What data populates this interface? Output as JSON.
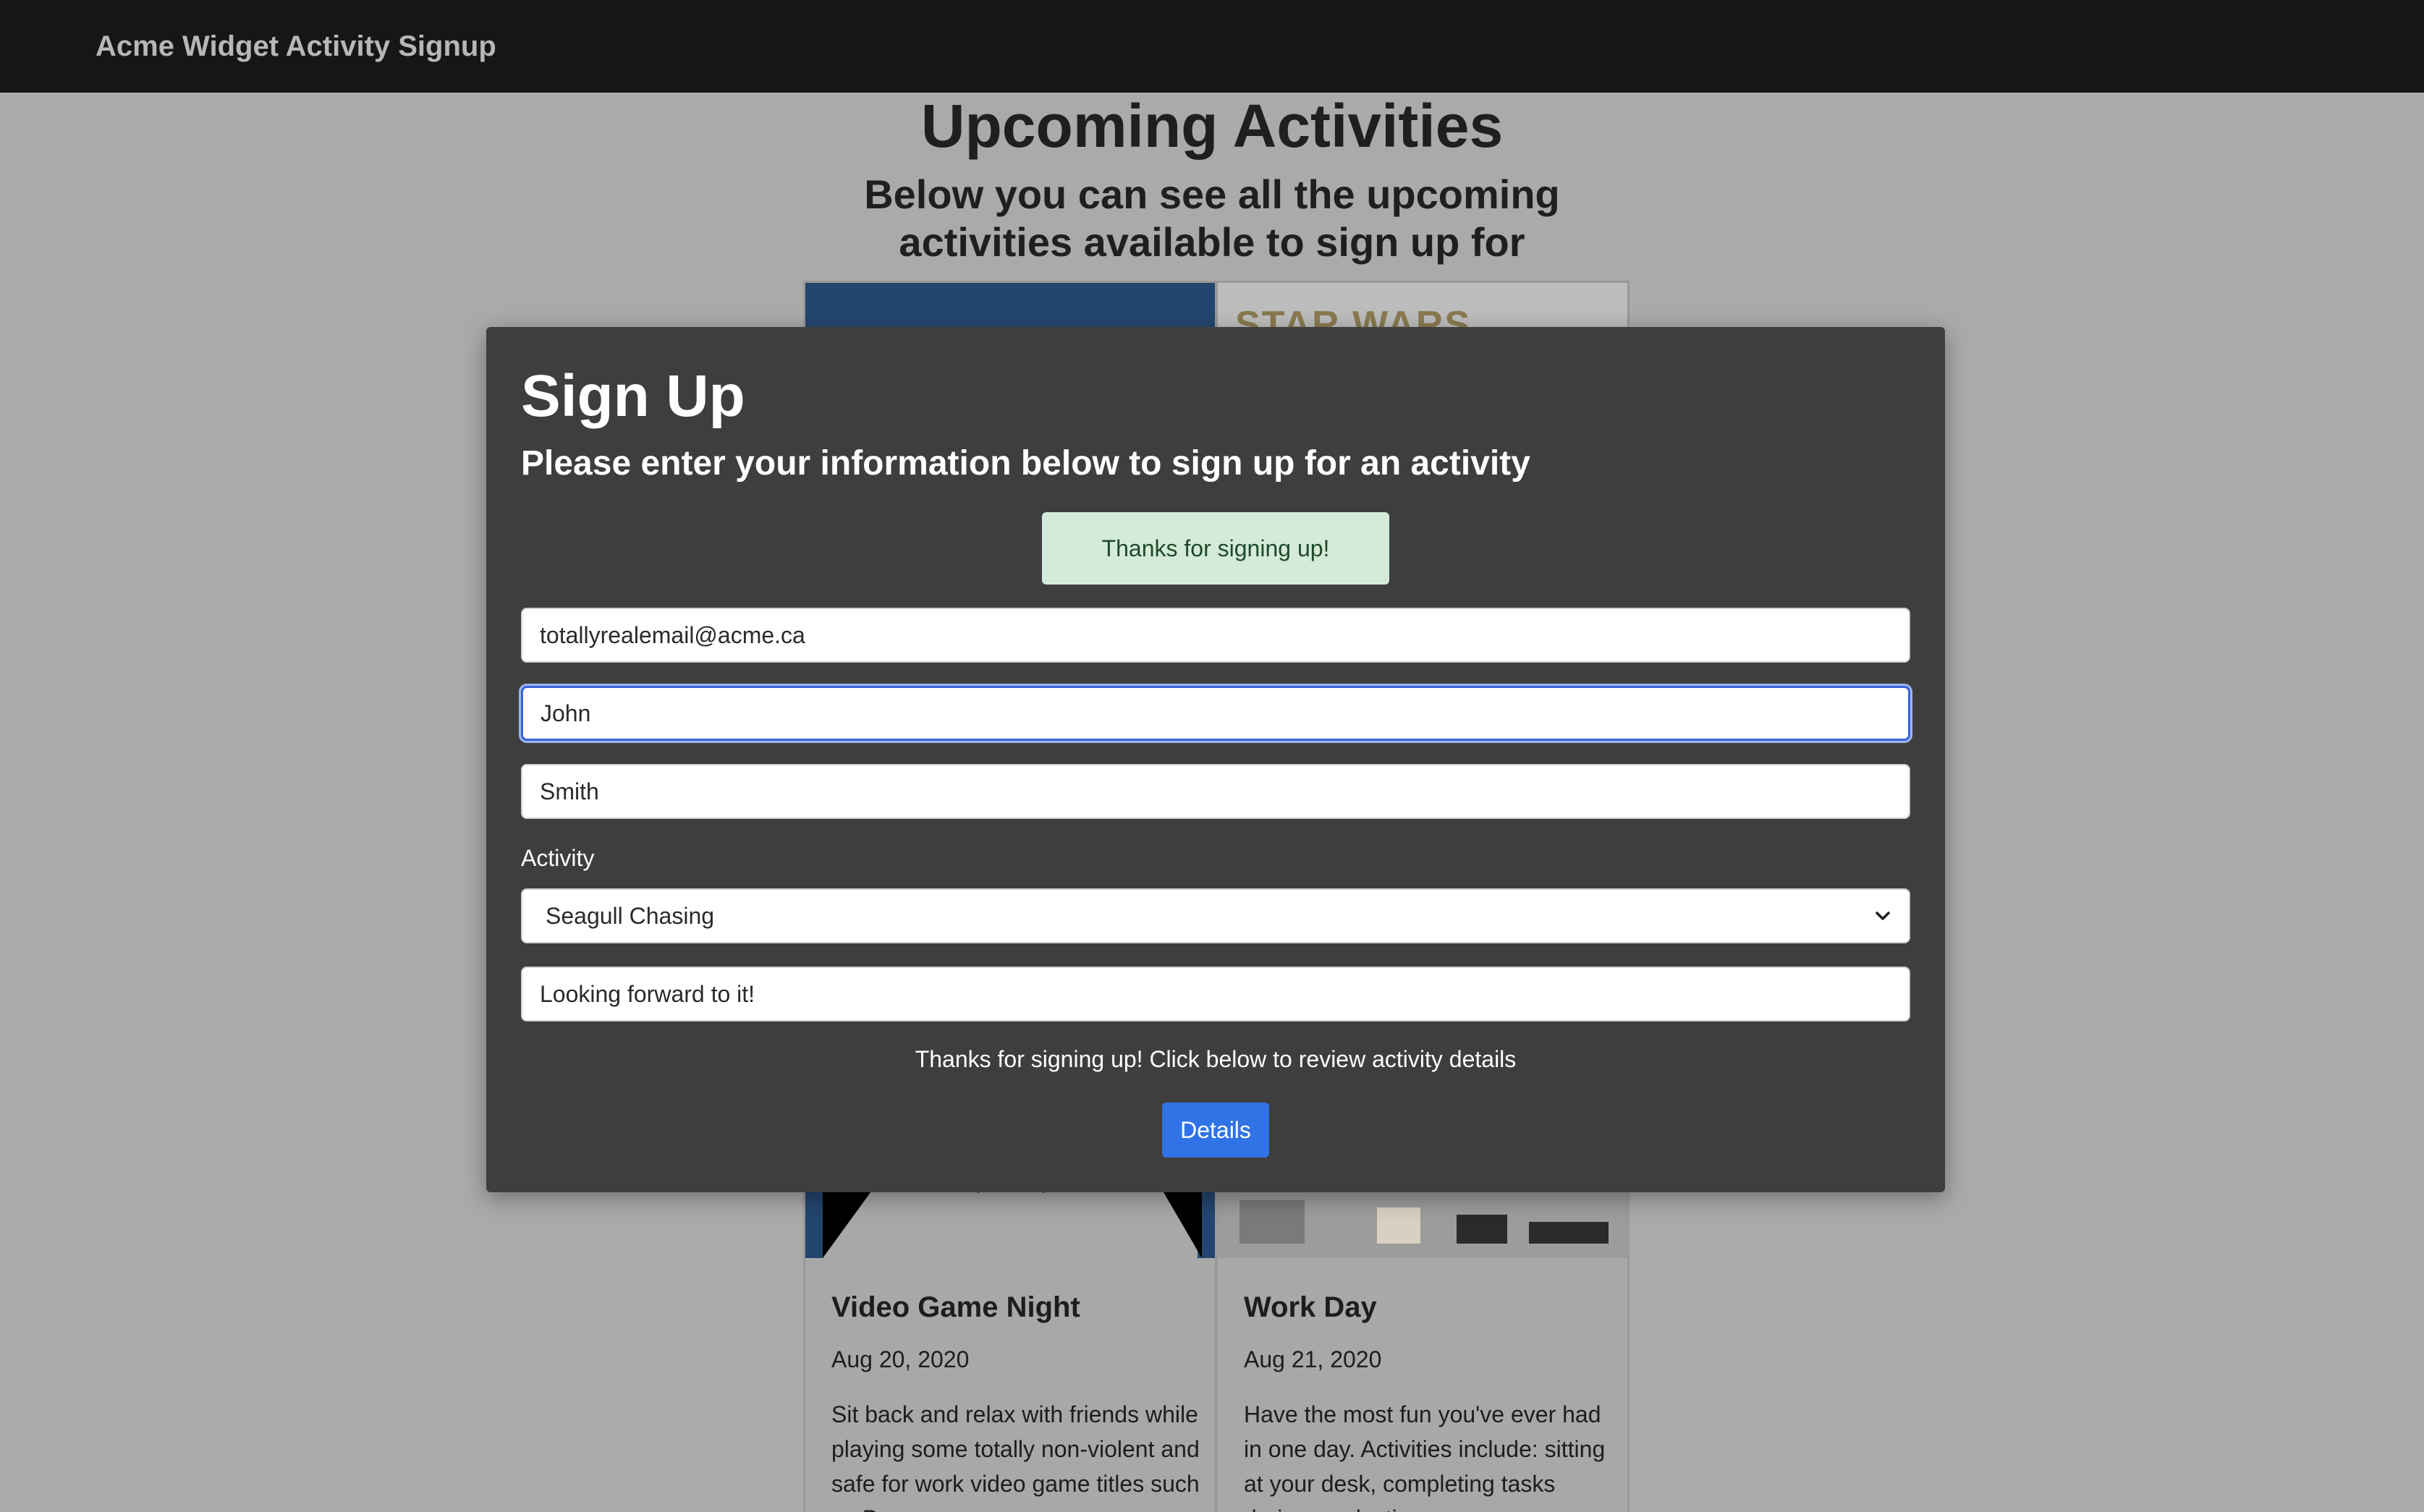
{
  "navbar": {
    "brand": "Acme Widget Activity Signup"
  },
  "page": {
    "title": "Upcoming Activities",
    "subtitle": "Below you can see all the upcoming activities available to sign up for"
  },
  "cards": [
    {
      "title": "Video Game Night",
      "date": "Aug 20, 2020",
      "description": "Sit back and relax with friends while playing some totally non-violent and safe for work video game titles such as P..."
    },
    {
      "title": "Work Day",
      "date": "Aug 21, 2020",
      "description": "Have the most fun you've ever had in one day. Activities include: sitting at your desk, completing tasks during production..."
    }
  ],
  "modal": {
    "title": "Sign Up",
    "subtitle": "Please enter your information below to sign up for an activity",
    "alert": "Thanks for signing up!",
    "email_value": "totallyrealemail@acme.ca",
    "first_name_value": "John",
    "last_name_value": "Smith",
    "activity_label": "Activity",
    "activity_selected": "Seagull Chasing",
    "comments_value": "Looking forward to it!",
    "thanks_text": "Thanks for signing up! Click below to review activity details",
    "details_label": "Details"
  },
  "colors": {
    "navbar_bg": "#161616",
    "page_bg": "#aaaaaa",
    "modal_bg": "#3e3e3e",
    "alert_bg": "#d4ebd9",
    "primary_button": "#2f73e6",
    "focus_border": "#3a64d8"
  },
  "icons": {
    "select_caret": "chevron-down-icon"
  }
}
